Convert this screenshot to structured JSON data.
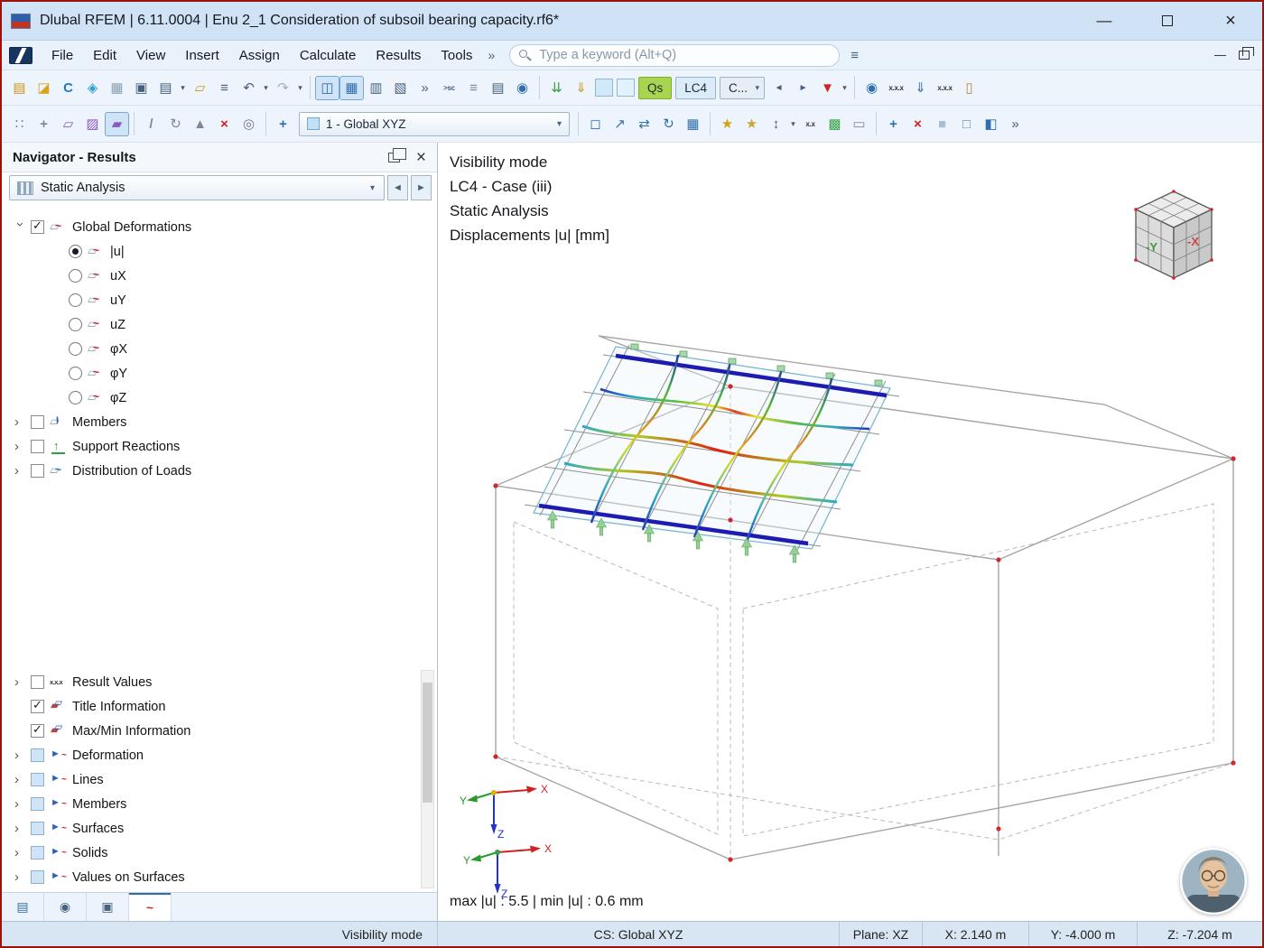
{
  "window": {
    "title": "Dlubal RFEM | 6.11.0004 | Enu 2_1 Consideration of subsoil bearing capacity.rf6*"
  },
  "colors": {
    "frame_red": "#9b1208",
    "titlebar_blue": "#cfe2f6",
    "toolbar_blue": "#eef4fb",
    "selection_blue": "#2f6fae",
    "qs_green": "#a8d44f",
    "result_max_red": "#e03018",
    "result_min_blue": "#1c1cb0",
    "support_green": "#97d097"
  },
  "menubar": {
    "items": [
      {
        "name": "menu-file",
        "label": "File"
      },
      {
        "name": "menu-edit",
        "label": "Edit"
      },
      {
        "name": "menu-view",
        "label": "View"
      },
      {
        "name": "menu-insert",
        "label": "Insert"
      },
      {
        "name": "menu-assign",
        "label": "Assign"
      },
      {
        "name": "menu-calculate",
        "label": "Calculate"
      },
      {
        "name": "menu-results",
        "label": "Results"
      },
      {
        "name": "menu-tools",
        "label": "Tools"
      }
    ],
    "overflow_glyph": "»",
    "search_placeholder": "Type a keyword (Alt+Q)",
    "adv_search_glyph": "≡"
  },
  "toolbar1": {
    "items_a": [
      {
        "name": "new-model-icon",
        "cls": "ic",
        "glyph": "▤",
        "style": "color:#c8981f"
      },
      {
        "name": "open-model-icon",
        "cls": "ic",
        "glyph": "◪",
        "style": "color:#d9a520"
      },
      {
        "name": "dlubal-connect-icon",
        "cls": "ic",
        "glyph": "C",
        "style": "color:#1f7ac2;font-weight:bold"
      },
      {
        "name": "model-cube-icon",
        "cls": "ic",
        "glyph": "◈",
        "style": "color:#2a9fd0"
      },
      {
        "name": "gallery-icon",
        "cls": "ic",
        "glyph": "▦",
        "style": "color:#8aa0b5"
      },
      {
        "name": "save-icon",
        "cls": "ic",
        "glyph": "▣",
        "style": "color:#46627e"
      },
      {
        "name": "print-icon",
        "cls": "ic",
        "glyph": "▤",
        "style": "color:#46627e"
      },
      {
        "name": "print-dropdown-icon",
        "cls": "dda",
        "glyph": "▾",
        "style": ""
      },
      {
        "name": "add-note-icon",
        "cls": "ic",
        "glyph": "▱",
        "style": "color:#c8981f"
      },
      {
        "name": "clipboard-icon",
        "cls": "ic",
        "glyph": "≡",
        "style": "color:#46627e"
      },
      {
        "name": "undo-icon",
        "cls": "ic",
        "glyph": "↶",
        "style": "color:#46627e"
      },
      {
        "name": "undo-dropdown-icon",
        "cls": "dda",
        "glyph": "▾",
        "style": ""
      },
      {
        "name": "redo-icon",
        "cls": "ic",
        "glyph": "↷",
        "style": "color:#9fb0bf"
      },
      {
        "name": "redo-dropdown-icon",
        "cls": "dda",
        "glyph": "▾",
        "style": ""
      },
      {
        "name": "separator",
        "cls": "sep",
        "glyph": "",
        "style": ""
      },
      {
        "name": "navigator-toggle-icon",
        "cls": "ic sel",
        "glyph": "◫",
        "style": "color:#2f6fae"
      },
      {
        "name": "tables-toggle-icon",
        "cls": "ic sel",
        "glyph": "▦",
        "style": "color:#2f6fae"
      },
      {
        "name": "result-diagrams-icon",
        "cls": "ic",
        "glyph": "▥",
        "style": "color:#46627e"
      },
      {
        "name": "sections-icon",
        "cls": "ic",
        "glyph": "▧",
        "style": "color:#46627e"
      },
      {
        "name": "expand-panel-icon",
        "cls": "ic",
        "glyph": "»",
        "style": "color:#46627e"
      },
      {
        "name": "sc-generator-icon",
        "cls": "ic txt",
        "glyph": ">sc",
        "style": "color:#46627e"
      },
      {
        "name": "layers-icon",
        "cls": "ic",
        "glyph": "≡",
        "style": "color:#7a8a9a"
      },
      {
        "name": "report-icon",
        "cls": "ic",
        "glyph": "▤",
        "style": "color:#46627e"
      },
      {
        "name": "web-services-icon",
        "cls": "ic",
        "glyph": "◉",
        "style": "color:#2f6fae"
      },
      {
        "name": "separator",
        "cls": "sep",
        "glyph": "",
        "style": ""
      },
      {
        "name": "member-loads-icon",
        "cls": "ic",
        "glyph": "⇊",
        "style": "color:#3aa04a"
      },
      {
        "name": "surface-loads-icon",
        "cls": "ic",
        "glyph": "⇓",
        "style": "color:#c8981f"
      },
      {
        "name": "load-color-swatch-1",
        "cls": "sw",
        "glyph": "",
        "style": "background:#cfe9f8"
      },
      {
        "name": "load-color-swatch-2",
        "cls": "sw",
        "glyph": "",
        "style": "background:#e2f1fb"
      }
    ],
    "qs_label": "Qs",
    "lc_label": "LC4",
    "c_label": "C...",
    "items_b": [
      {
        "name": "previous-case-icon",
        "cls": "ic sm",
        "glyph": "◄",
        "style": "color:#46627e"
      },
      {
        "name": "next-case-icon",
        "cls": "ic sm",
        "glyph": "►",
        "style": "color:#46627e"
      },
      {
        "name": "filter-results-icon",
        "cls": "ic",
        "glyph": "▼",
        "style": "color:#cc2222"
      },
      {
        "name": "filter-dropdown-icon",
        "cls": "dda",
        "glyph": "▾",
        "style": ""
      },
      {
        "name": "separator",
        "cls": "sep",
        "glyph": "",
        "style": ""
      },
      {
        "name": "show-results-icon",
        "cls": "ic",
        "glyph": "◉",
        "style": "color:#2f6fae"
      },
      {
        "name": "result-values-icon",
        "cls": "ic txt",
        "glyph": "x.x.x",
        "style": "color:#333"
      },
      {
        "name": "show-minmax-icon",
        "cls": "ic",
        "glyph": "⇓",
        "style": "color:#2f6fae"
      },
      {
        "name": "extreme-values-icon",
        "cls": "ic txt",
        "glyph": "x.x.x",
        "style": "color:#333"
      },
      {
        "name": "clipping-object-icon",
        "cls": "ic",
        "glyph": "▯",
        "style": "color:#b5854a"
      }
    ]
  },
  "toolbar2": {
    "items_a": [
      {
        "name": "point-grid-icon",
        "cls": "ic",
        "glyph": "∷",
        "style": "color:#7a8a9a"
      },
      {
        "name": "snap-icon",
        "cls": "ic",
        "glyph": "+",
        "style": "color:#7a8a9a;font-weight:bold"
      },
      {
        "name": "workplane-xy-icon",
        "cls": "ic",
        "glyph": "▱",
        "style": "color:#8a5ac2"
      },
      {
        "name": "workplane-xz-icon",
        "cls": "ic",
        "glyph": "▨",
        "style": "color:#8a5ac2"
      },
      {
        "name": "workplane-yz-icon",
        "cls": "ic sel",
        "glyph": "▰",
        "style": "color:#8a5ac2"
      },
      {
        "name": "separator",
        "cls": "sep",
        "glyph": "",
        "style": ""
      },
      {
        "name": "guidelines-icon",
        "cls": "ic",
        "glyph": "/",
        "style": "color:#7a8a9a;font-weight:bold"
      },
      {
        "name": "rotate-plane-icon",
        "cls": "ic",
        "glyph": "↻",
        "style": "color:#7a8a9a"
      },
      {
        "name": "mirror-icon",
        "cls": "ic",
        "glyph": "▲",
        "style": "color:#7a8a9a"
      },
      {
        "name": "delete-selection-icon",
        "cls": "ic",
        "glyph": "×",
        "style": "color:#cc2222;font-weight:bold"
      },
      {
        "name": "plane-settings-icon",
        "cls": "ic",
        "glyph": "◎",
        "style": "color:#6a7a8a"
      },
      {
        "name": "separator",
        "cls": "sep",
        "glyph": "",
        "style": ""
      },
      {
        "name": "cs-tool-icon",
        "cls": "ic",
        "glyph": "+",
        "style": "color:#2f6fae;font-weight:bold"
      }
    ],
    "cs_label": "1 - Global XYZ",
    "items_b": [
      {
        "name": "separator",
        "cls": "sep",
        "glyph": "",
        "style": ""
      },
      {
        "name": "select-window-icon",
        "cls": "ic",
        "glyph": "◻",
        "style": "color:#2f6fae"
      },
      {
        "name": "move-entities-icon",
        "cls": "ic",
        "glyph": "↗",
        "style": "color:#2f6fae"
      },
      {
        "name": "copy-entities-icon",
        "cls": "ic",
        "glyph": "⇄",
        "style": "color:#2f6fae"
      },
      {
        "name": "rotate-entities-icon",
        "cls": "ic",
        "glyph": "↻",
        "style": "color:#2f6fae"
      },
      {
        "name": "project-entities-icon",
        "cls": "ic",
        "glyph": "▦",
        "style": "color:#2f6fae"
      },
      {
        "name": "separator",
        "cls": "sep",
        "glyph": "",
        "style": ""
      },
      {
        "name": "generate-combinations-icon",
        "cls": "ic",
        "glyph": "★",
        "style": "color:#d4a017"
      },
      {
        "name": "combination-wizard-icon",
        "cls": "ic",
        "glyph": "★",
        "style": "color:#caa53a"
      },
      {
        "name": "minmax-values-icon",
        "cls": "ic",
        "glyph": "↕",
        "style": "color:#46627e"
      },
      {
        "name": "minmax-dropdown-icon",
        "cls": "dda",
        "glyph": "▾",
        "style": ""
      },
      {
        "name": "xx-values-icon",
        "cls": "ic txt",
        "glyph": "x.x",
        "style": "color:#333"
      },
      {
        "name": "mesh-generate-icon",
        "cls": "ic",
        "glyph": "▩",
        "style": "color:#3aa04a"
      },
      {
        "name": "mesh-settings-icon",
        "cls": "ic",
        "glyph": "▭",
        "style": "color:#7a8a9a"
      },
      {
        "name": "separator",
        "cls": "sep",
        "glyph": "",
        "style": ""
      },
      {
        "name": "zoom-select-icon",
        "cls": "ic",
        "glyph": "+",
        "style": "color:#2f6fae;font-weight:bold"
      },
      {
        "name": "delete-results-icon",
        "cls": "ic",
        "glyph": "×",
        "style": "color:#cc2222;font-weight:bold"
      },
      {
        "name": "solid-view-icon",
        "cls": "ic",
        "glyph": "■",
        "style": "color:#a8c0d4"
      },
      {
        "name": "wireframe-view-icon",
        "cls": "ic",
        "glyph": "□",
        "style": "color:#6a8aa8"
      },
      {
        "name": "section-view-icon",
        "cls": "ic",
        "glyph": "◧",
        "style": "color:#2f6fae"
      },
      {
        "name": "more-tools-icon",
        "cls": "ic",
        "glyph": "»",
        "style": "color:#46627e"
      }
    ]
  },
  "navigator": {
    "title": "Navigator - Results",
    "analysis_label": "Static Analysis",
    "tree_upper": [
      {
        "ind": "i0",
        "exp": "e-d",
        "ctl": "cbc",
        "icon": "ic-def",
        "label": "Global Deformations"
      },
      {
        "ind": "i1",
        "exp": "e-n",
        "ctl": "rads",
        "icon": "ic-def",
        "label": "|u|"
      },
      {
        "ind": "i1",
        "exp": "e-n",
        "ctl": "rad",
        "icon": "ic-def",
        "label": "uX"
      },
      {
        "ind": "i1",
        "exp": "e-n",
        "ctl": "rad",
        "icon": "ic-def",
        "label": "uY"
      },
      {
        "ind": "i1",
        "exp": "e-n",
        "ctl": "rad",
        "icon": "ic-def",
        "label": "uZ"
      },
      {
        "ind": "i1",
        "exp": "e-n",
        "ctl": "rad",
        "icon": "ic-def",
        "label": "φX"
      },
      {
        "ind": "i1",
        "exp": "e-n",
        "ctl": "rad",
        "icon": "ic-def",
        "label": "φY"
      },
      {
        "ind": "i1",
        "exp": "e-n",
        "ctl": "rad",
        "icon": "ic-def",
        "label": "φZ"
      },
      {
        "ind": "i0",
        "exp": "e-r",
        "ctl": "cb",
        "icon": "ic-mem",
        "label": "Members"
      },
      {
        "ind": "i0",
        "exp": "e-r",
        "ctl": "cb",
        "icon": "ic-sup",
        "label": "Support Reactions"
      },
      {
        "ind": "i0",
        "exp": "e-r",
        "ctl": "cb",
        "icon": "ic-dist",
        "label": "Distribution of Loads"
      }
    ],
    "tree_lower": [
      {
        "ind": "i0",
        "exp": "e-r",
        "ctl": "cb",
        "icon": "ic-xxx",
        "label": "Result Values"
      },
      {
        "ind": "i0",
        "exp": "e-n",
        "ctl": "cbc",
        "icon": "ic-info",
        "label": "Title Information"
      },
      {
        "ind": "i0",
        "exp": "e-n",
        "ctl": "cbc",
        "icon": "ic-info",
        "label": "Max/Min Information"
      },
      {
        "ind": "i0",
        "exp": "e-r",
        "ctl": "cbb",
        "icon": "ic-disp",
        "label": "Deformation"
      },
      {
        "ind": "i0",
        "exp": "e-r",
        "ctl": "cbb",
        "icon": "ic-disp",
        "label": "Lines"
      },
      {
        "ind": "i0",
        "exp": "e-r",
        "ctl": "cbb",
        "icon": "ic-disp",
        "label": "Members"
      },
      {
        "ind": "i0",
        "exp": "e-r",
        "ctl": "cbb",
        "icon": "ic-disp",
        "label": "Surfaces"
      },
      {
        "ind": "i0",
        "exp": "e-r",
        "ctl": "cbb",
        "icon": "ic-disp",
        "label": "Solids"
      },
      {
        "ind": "i0",
        "exp": "e-r",
        "ctl": "cbb",
        "icon": "ic-disp",
        "label": "Values on Surfaces"
      }
    ],
    "tabs": [
      {
        "name": "tab-data",
        "cls": "",
        "glyph": "▤",
        "style": "color:#2f6fae"
      },
      {
        "name": "tab-visibility",
        "cls": "",
        "glyph": "◉",
        "style": "color:#46627e"
      },
      {
        "name": "tab-views",
        "cls": "",
        "glyph": "▣",
        "style": "color:#46627e"
      },
      {
        "name": "tab-results",
        "cls": "active",
        "glyph": "~",
        "style": "color:#cc2222;font-weight:bold"
      }
    ]
  },
  "viewport": {
    "info_lines": [
      "Visibility mode",
      "LC4 - Case (iii)",
      "Static Analysis",
      "Displacements |u| [mm]"
    ],
    "maxmin": "max |u| : 5.5 | min |u| : 0.6 mm",
    "cube": {
      "neg_y": "-Y",
      "neg_x": "-X"
    },
    "axes": {
      "x": "X",
      "y": "Y",
      "z": "Z"
    }
  },
  "statusbar": {
    "mode": "Visibility mode",
    "cs": "CS: Global XYZ",
    "plane": "Plane: XZ",
    "x": "X: 2.140 m",
    "y": "Y: -4.000 m",
    "z": "Z: -7.204 m"
  }
}
